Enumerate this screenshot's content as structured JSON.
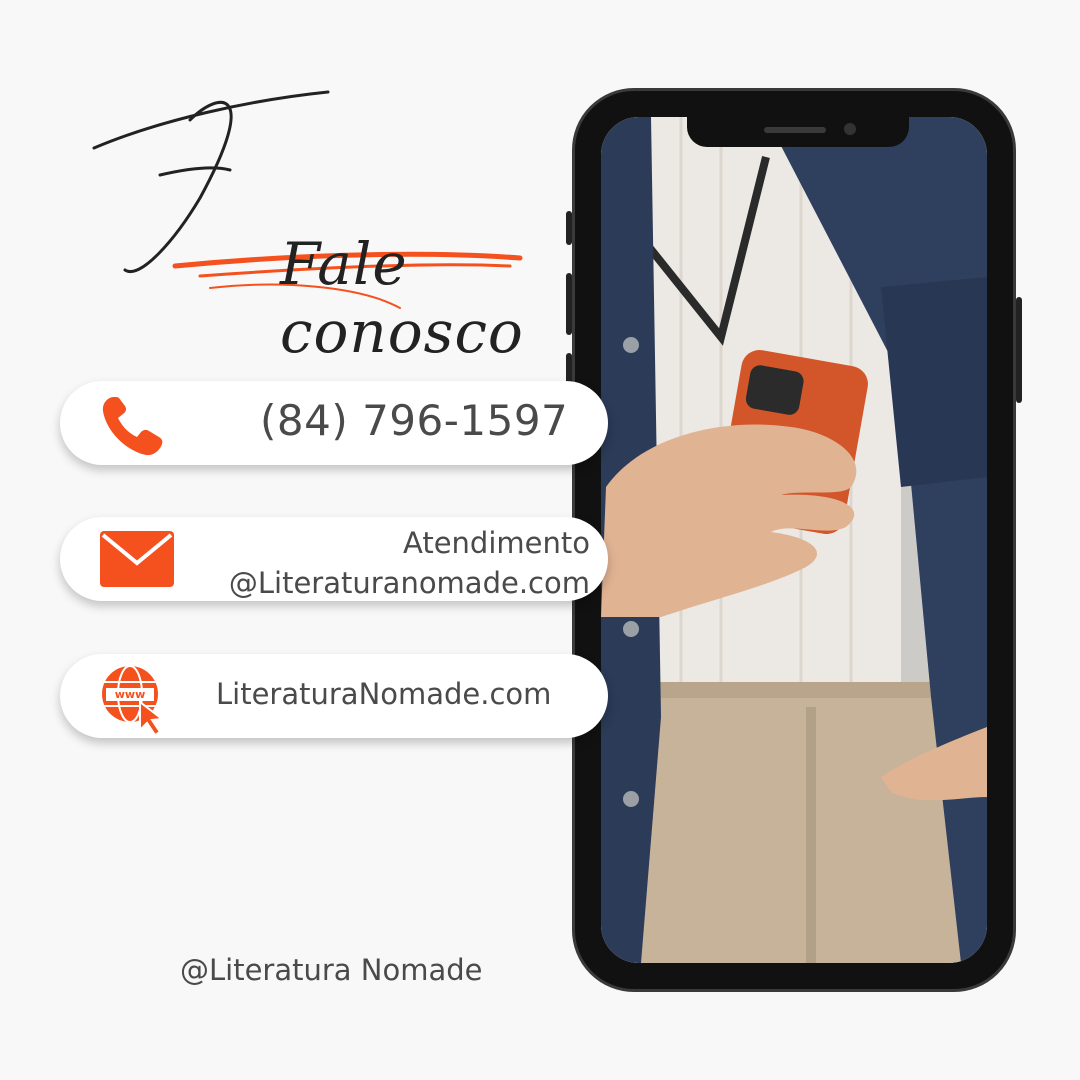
{
  "title": "Fale conosco",
  "contacts": {
    "phone": {
      "icon": "phone-icon",
      "text": "(84) 796-1597"
    },
    "email": {
      "icon": "envelope-icon",
      "line1": "Atendimento",
      "line2": "@Literaturanomade.com"
    },
    "website": {
      "icon": "www-globe-cursor-icon",
      "text": "LiteraturaNomade.com"
    }
  },
  "footer": {
    "handle": "@Literatura Nomade"
  },
  "colors": {
    "accent": "#f4511e",
    "text": "#4a4a4a",
    "background": "#f8f8f8"
  }
}
